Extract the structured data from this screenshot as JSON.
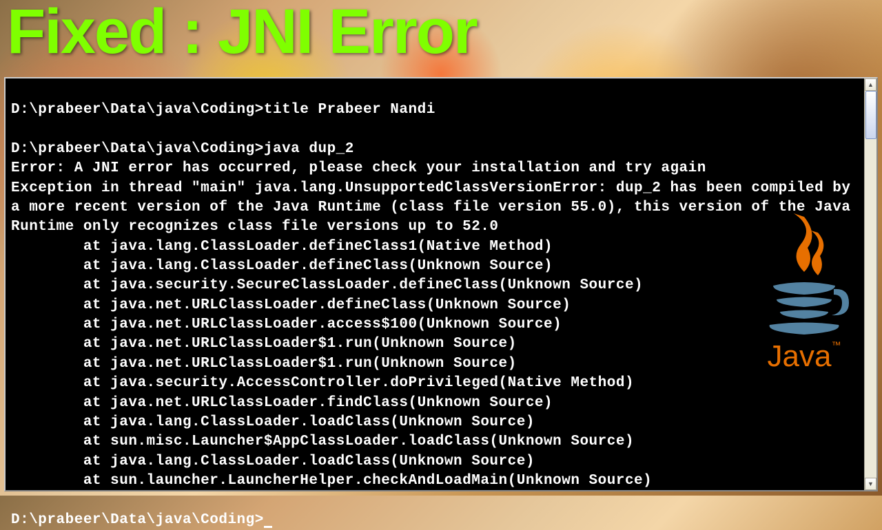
{
  "banner": {
    "title": "Fixed : JNI Error"
  },
  "terminal": {
    "prompt": "D:\\prabeer\\Data\\java\\Coding>",
    "cmd1": "title Prabeer Nandi",
    "cmd2": "java dup_2",
    "error_line": "Error: A JNI error has occurred, please check your installation and try again",
    "exception_wrap": "Exception in thread \"main\" java.lang.UnsupportedClassVersionError: dup_2 has been compiled by a more recent version of the Java Runtime (class file version 55.0), this version of the Java Runtime only recognizes class file versions up to 52.0",
    "stack": [
      "        at java.lang.ClassLoader.defineClass1(Native Method)",
      "        at java.lang.ClassLoader.defineClass(Unknown Source)",
      "        at java.security.SecureClassLoader.defineClass(Unknown Source)",
      "        at java.net.URLClassLoader.defineClass(Unknown Source)",
      "        at java.net.URLClassLoader.access$100(Unknown Source)",
      "        at java.net.URLClassLoader$1.run(Unknown Source)",
      "        at java.net.URLClassLoader$1.run(Unknown Source)",
      "        at java.security.AccessController.doPrivileged(Native Method)",
      "        at java.net.URLClassLoader.findClass(Unknown Source)",
      "        at java.lang.ClassLoader.loadClass(Unknown Source)",
      "        at sun.misc.Launcher$AppClassLoader.loadClass(Unknown Source)",
      "        at java.lang.ClassLoader.loadClass(Unknown Source)",
      "        at sun.launcher.LauncherHelper.checkAndLoadMain(Unknown Source)"
    ]
  },
  "logo": {
    "text": "Java",
    "tm": "™"
  }
}
